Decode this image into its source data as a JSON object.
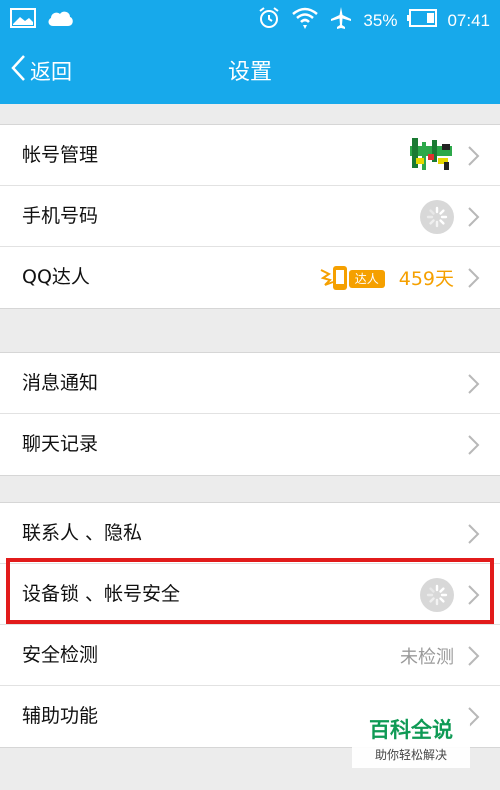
{
  "status_bar": {
    "battery": "35%",
    "time": "07:41",
    "icons": [
      "image-icon",
      "cloud-icon",
      "alarm-icon",
      "wifi-icon",
      "airplane-icon",
      "battery-icon"
    ]
  },
  "nav": {
    "back_label": "返回",
    "title": "设置"
  },
  "groups": [
    {
      "rows": [
        {
          "label": "帐号管理",
          "accessory": "qr-code-thumbnail"
        },
        {
          "label": "手机号码",
          "accessory": "loading-spinner"
        },
        {
          "label": "QQ达人",
          "badge": "达人",
          "days": "459天"
        }
      ]
    },
    {
      "rows": [
        {
          "label": "消息通知"
        },
        {
          "label": "聊天记录"
        }
      ]
    },
    {
      "rows": [
        {
          "label": "联系人 、隐私"
        },
        {
          "label": "设备锁 、帐号安全",
          "accessory": "loading-spinner",
          "highlighted": true
        },
        {
          "label": "安全检测",
          "status": "未检测"
        },
        {
          "label": "辅助功能"
        }
      ]
    }
  ],
  "watermark": {
    "title": "百科全说",
    "subtitle": "助你轻松解决"
  },
  "colors": {
    "header": "#17a9eb",
    "highlight_border": "#e21b1b",
    "days": "#f5a000",
    "watermark": "#0f9a55"
  }
}
